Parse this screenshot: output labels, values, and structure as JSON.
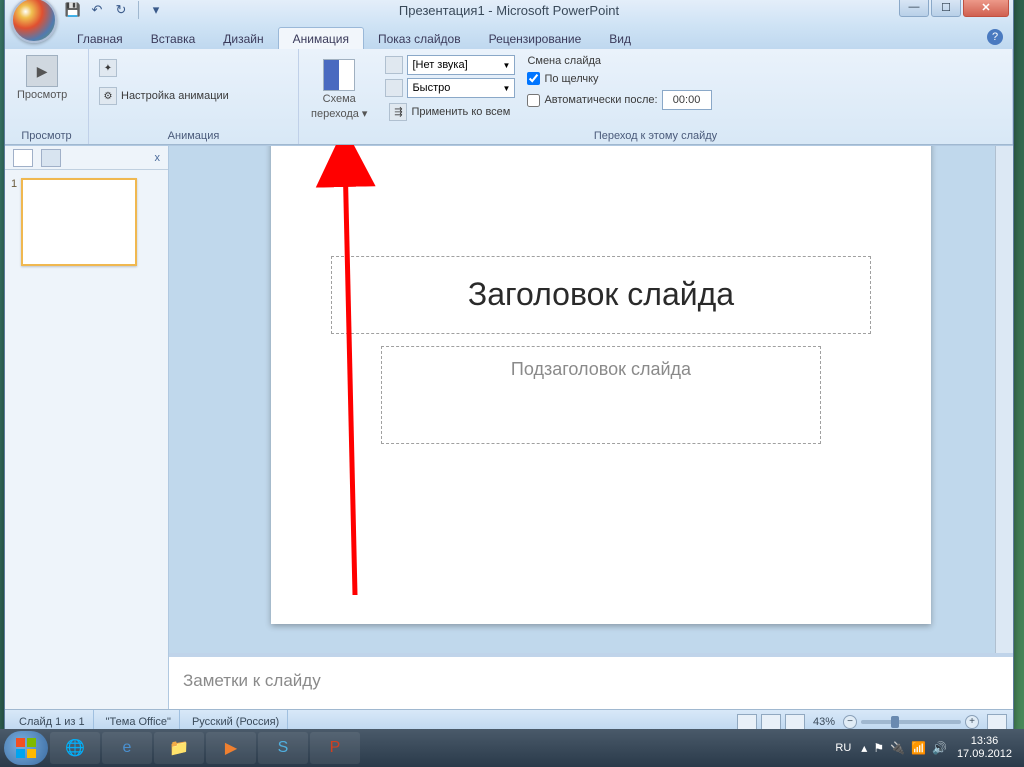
{
  "title": "Презентация1 - Microsoft PowerPoint",
  "tabs": {
    "home": "Главная",
    "insert": "Вставка",
    "design": "Дизайн",
    "animation": "Анимация",
    "slideshow": "Показ слайдов",
    "review": "Рецензирование",
    "view": "Вид"
  },
  "ribbon": {
    "preview_btn": "Просмотр",
    "preview_group": "Просмотр",
    "anim_settings": "Настройка анимации",
    "anim_group": "Анимация",
    "transition_scheme": "Схема",
    "transition_scheme2": "перехода",
    "sound_label": "[Нет звука]",
    "speed_label": "Быстро",
    "apply_all": "Применить ко всем",
    "advance_title": "Смена слайда",
    "on_click": "По щелчку",
    "after": "Автоматически после:",
    "after_time": "00:00",
    "transition_group": "Переход к этому слайду"
  },
  "panel": {
    "close": "x",
    "slide_num": "1"
  },
  "slide": {
    "title_placeholder": "Заголовок слайда",
    "subtitle_placeholder": "Подзаголовок слайда"
  },
  "notes": "Заметки к слайду",
  "status": {
    "slide_of": "Слайд 1 из 1",
    "theme": "\"Тема Office\"",
    "lang": "Русский (Россия)",
    "zoom": "43%"
  },
  "taskbar": {
    "lang": "RU",
    "time": "13:36",
    "date": "17.09.2012"
  }
}
